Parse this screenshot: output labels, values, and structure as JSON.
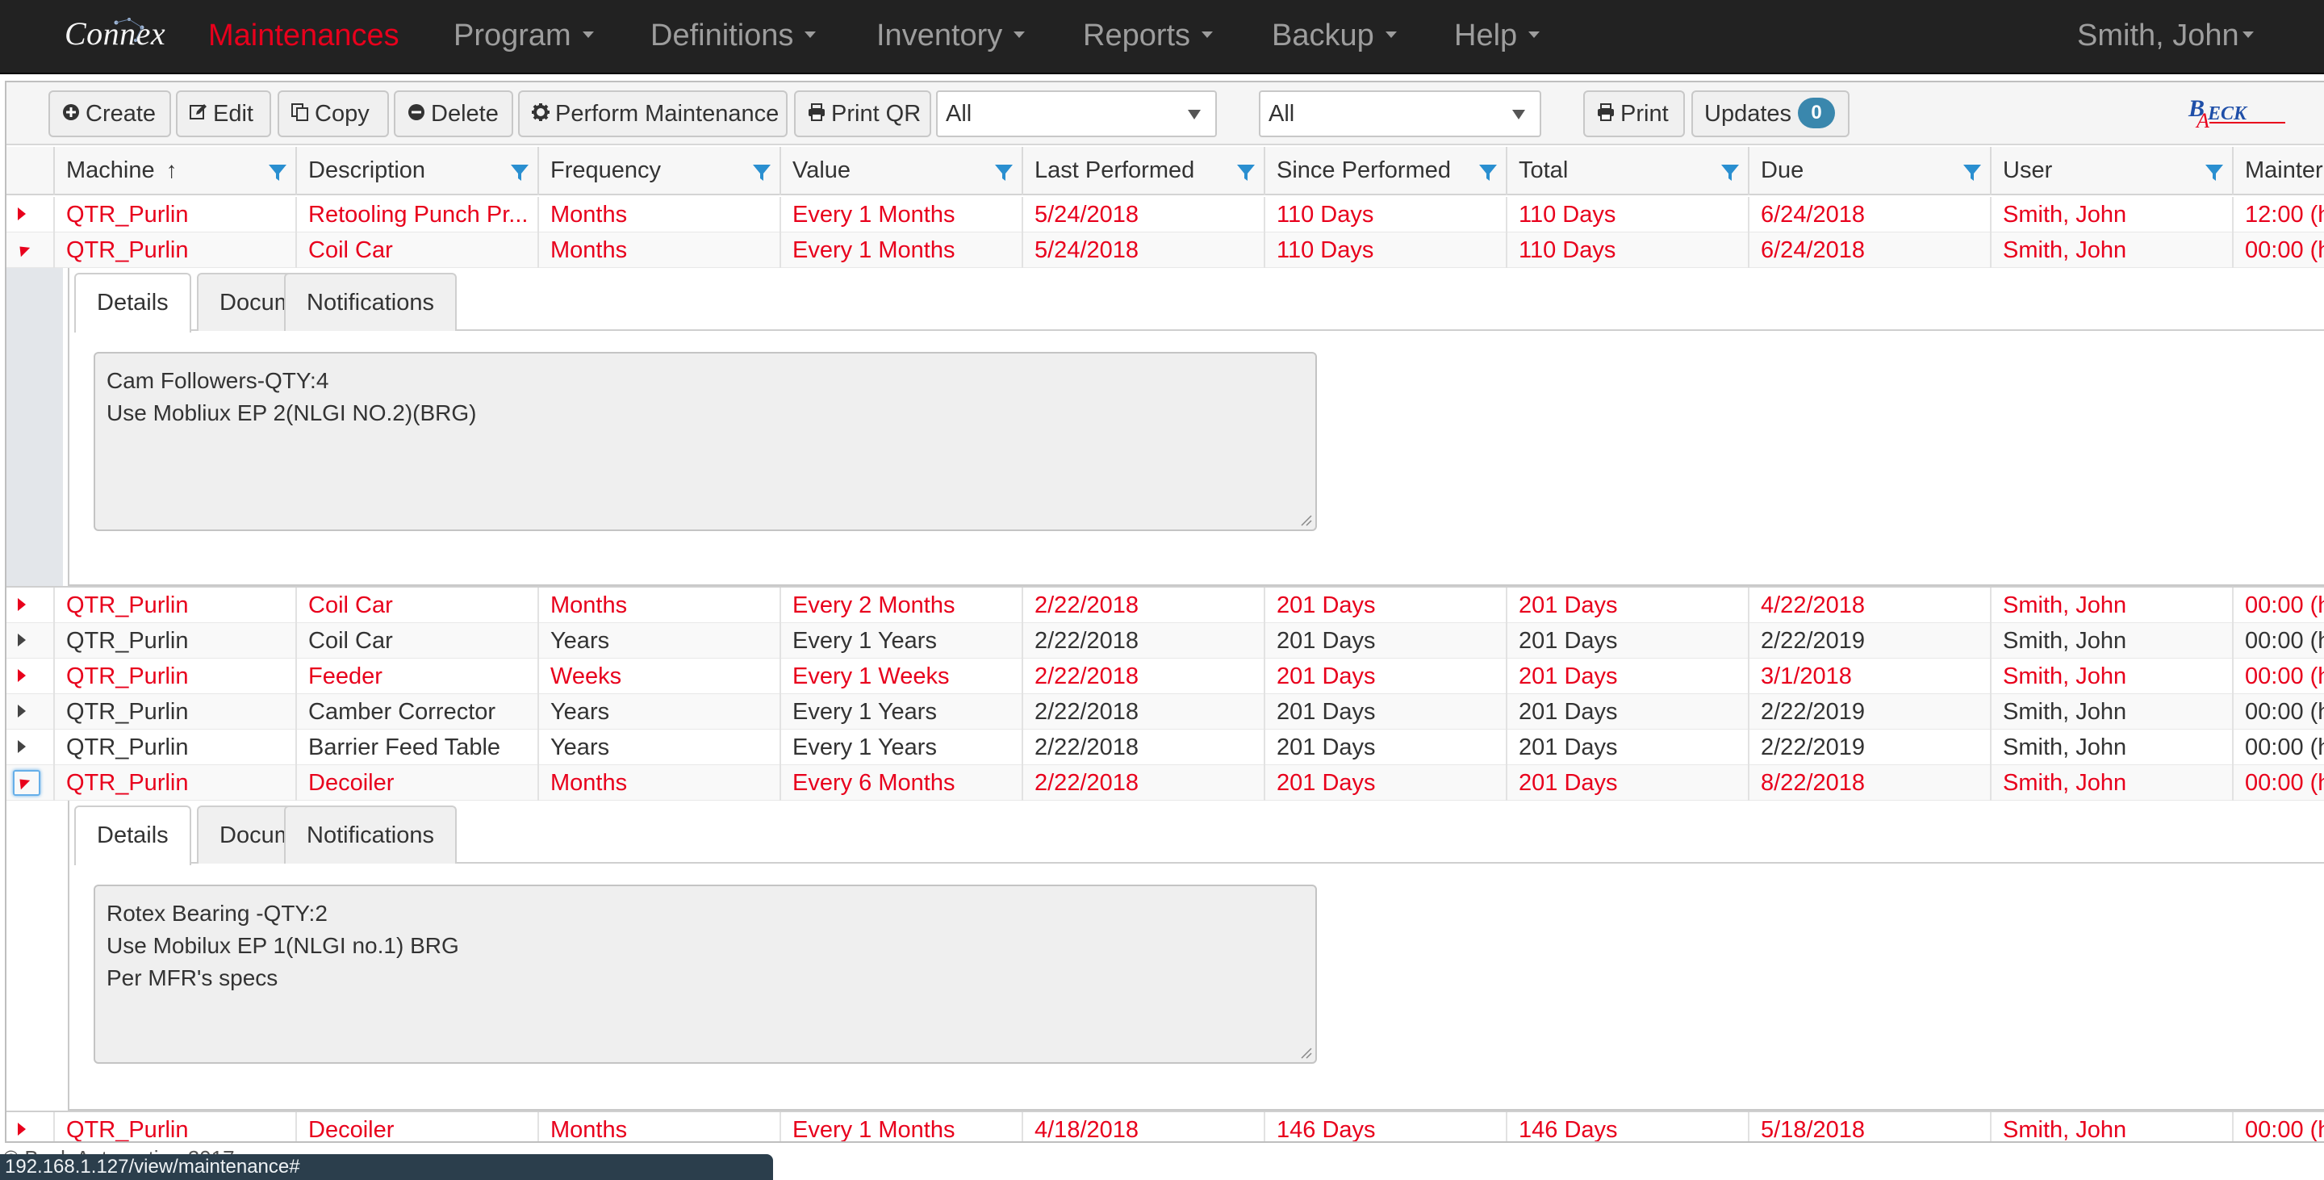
{
  "nav": {
    "brand": "Connex",
    "items": [
      {
        "label": "Maintenances",
        "active": true,
        "dropdown": false
      },
      {
        "label": "Program",
        "active": false,
        "dropdown": true
      },
      {
        "label": "Definitions",
        "active": false,
        "dropdown": true
      },
      {
        "label": "Inventory",
        "active": false,
        "dropdown": true
      },
      {
        "label": "Reports",
        "active": false,
        "dropdown": true
      },
      {
        "label": "Backup",
        "active": false,
        "dropdown": true
      },
      {
        "label": "Help",
        "active": false,
        "dropdown": true
      }
    ],
    "user": "Smith, John"
  },
  "toolbar": {
    "create": "Create",
    "edit": "Edit",
    "copy": "Copy",
    "delete": "Delete",
    "perform": "Perform Maintenance",
    "print_qr": "Print QR",
    "filter1": "All",
    "filter2": "All",
    "print": "Print",
    "updates": "Updates",
    "updates_count": "0"
  },
  "grid": {
    "columns": [
      "Machine",
      "Description",
      "Frequency",
      "Value",
      "Last Performed",
      "Since Performed",
      "Total",
      "Due",
      "User",
      "Mainter"
    ],
    "rows": [
      {
        "status": "overdue",
        "expanded": false,
        "cells": [
          "QTR_Purlin",
          "Retooling Punch Pr...",
          "Months",
          "Every 1 Months",
          "5/24/2018",
          "110 Days",
          "110 Days",
          "6/24/2018",
          "Smith, John",
          "12:00 (h"
        ]
      },
      {
        "status": "overdue",
        "expanded": true,
        "cells": [
          "QTR_Purlin",
          "Coil Car",
          "Months",
          "Every 1 Months",
          "5/24/2018",
          "110 Days",
          "110 Days",
          "6/24/2018",
          "Smith, John",
          "00:00 (h"
        ]
      },
      {
        "status": "overdue",
        "expanded": false,
        "cells": [
          "QTR_Purlin",
          "Coil Car",
          "Months",
          "Every 2 Months",
          "2/22/2018",
          "201 Days",
          "201 Days",
          "4/22/2018",
          "Smith, John",
          "00:00 (h"
        ]
      },
      {
        "status": "ok",
        "expanded": false,
        "cells": [
          "QTR_Purlin",
          "Coil Car",
          "Years",
          "Every 1 Years",
          "2/22/2018",
          "201 Days",
          "201 Days",
          "2/22/2019",
          "Smith, John",
          "00:00 (h"
        ]
      },
      {
        "status": "overdue",
        "expanded": false,
        "cells": [
          "QTR_Purlin",
          "Feeder",
          "Weeks",
          "Every 1 Weeks",
          "2/22/2018",
          "201 Days",
          "201 Days",
          "3/1/2018",
          "Smith, John",
          "00:00 (h"
        ]
      },
      {
        "status": "ok",
        "expanded": false,
        "cells": [
          "QTR_Purlin",
          "Camber Corrector",
          "Years",
          "Every 1 Years",
          "2/22/2018",
          "201 Days",
          "201 Days",
          "2/22/2019",
          "Smith, John",
          "00:00 (h"
        ]
      },
      {
        "status": "ok",
        "expanded": false,
        "cells": [
          "QTR_Purlin",
          "Barrier Feed Table",
          "Years",
          "Every 1 Years",
          "2/22/2018",
          "201 Days",
          "201 Days",
          "2/22/2019",
          "Smith, John",
          "00:00 (h"
        ]
      },
      {
        "status": "overdue",
        "expanded": true,
        "cells": [
          "QTR_Purlin",
          "Decoiler",
          "Months",
          "Every 6 Months",
          "2/22/2018",
          "201 Days",
          "201 Days",
          "8/22/2018",
          "Smith, John",
          "00:00 (h"
        ]
      },
      {
        "status": "overdue",
        "expanded": false,
        "cells": [
          "QTR_Purlin",
          "Decoiler",
          "Months",
          "Every 1 Months",
          "4/18/2018",
          "146 Days",
          "146 Days",
          "5/18/2018",
          "Smith, John",
          "00:00 (h"
        ]
      }
    ]
  },
  "details": [
    {
      "tabs": [
        "Details",
        "Documents",
        "Notifications"
      ],
      "active_tab": "Details",
      "notes": [
        "Cam Followers-QTY:4",
        "Use Mobliux EP 2(NLGI NO.2)(BRG)"
      ]
    },
    {
      "tabs": [
        "Details",
        "Documents",
        "Notifications"
      ],
      "active_tab": "Details",
      "notes": [
        "Rotex Bearing -QTY:2",
        "Use Mobilux EP 1(NLGI no.1) BRG",
        "Per MFR's specs"
      ]
    }
  ],
  "footer": {
    "copyright": "© Beck Automation 2017",
    "status_url": "192.168.1.127/view/maintenance#"
  },
  "colors": {
    "overdue": "#e8001c",
    "ok": "#333333",
    "filter_icon": "#2a8fd0",
    "badge": "#3a87ad"
  }
}
